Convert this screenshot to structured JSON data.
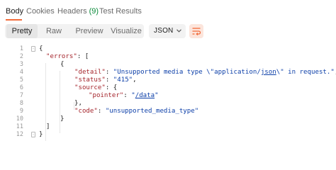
{
  "response_tabs": {
    "body": "Body",
    "cookies": "Cookies",
    "headers": "Headers",
    "headers_count": "(9)",
    "test_results": "Test Results"
  },
  "view_modes": {
    "pretty": "Pretty",
    "raw": "Raw",
    "preview": "Preview",
    "visualize": "Visualize"
  },
  "format": {
    "selected": "JSON"
  },
  "icons": {
    "format_chevron": "chevron-down-icon",
    "wrap": "wrap-lines-icon",
    "fold": "fold-toggle-icon"
  },
  "colors": {
    "accent": "#f26b3a",
    "key": "#a4242b",
    "string": "#0b3ea8",
    "count": "#0a8a3a"
  },
  "code": {
    "line_numbers": [
      "1",
      "2",
      "3",
      "4",
      "5",
      "6",
      "7",
      "8",
      "9",
      "10",
      "11",
      "12"
    ],
    "l1": {
      "open": "{"
    },
    "l2": {
      "key": "\"errors\"",
      "punct": ": ["
    },
    "l3": {
      "open": "{"
    },
    "l4": {
      "key": "\"detail\"",
      "colon": ": ",
      "val_a": "\"Unsupported media type \\\"application/",
      "val_link": "json",
      "val_b": "\\\" in request.\"",
      "comma": ","
    },
    "l5": {
      "key": "\"status\"",
      "colon": ": ",
      "val": "\"415\"",
      "comma": ","
    },
    "l6": {
      "key": "\"source\"",
      "punct": ": {"
    },
    "l7": {
      "key": "\"pointer\"",
      "colon": ": ",
      "val_q1": "\"",
      "val_link": "/data",
      "val_q2": "\""
    },
    "l8": {
      "close": "},"
    },
    "l9": {
      "key": "\"code\"",
      "colon": ": ",
      "val": "\"unsupported_media_type\""
    },
    "l10": {
      "close": "}"
    },
    "l11": {
      "close": "]"
    },
    "l12": {
      "close": "}"
    }
  }
}
